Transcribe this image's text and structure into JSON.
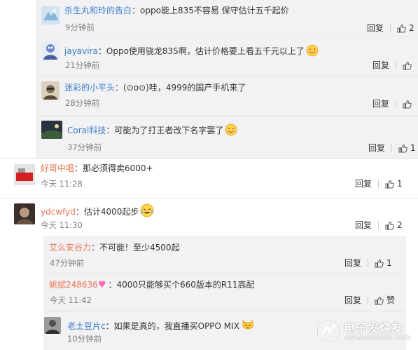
{
  "colors": {
    "nick_orange": "#eb7350",
    "nick_blue": "#3c7ec6",
    "panel_bg": "#f2f2f5",
    "heart": "#ff69b4"
  },
  "comments": [
    {
      "user": "杀生丸和玲的告白",
      "text": "oppo能上835不容易 保守估计五千起价",
      "time": "9分钟前",
      "reply": "回复",
      "likes": "2",
      "emoji": ""
    },
    {
      "user": "jayavira",
      "text": "Oppo使用骁龙835啊，估计价格要上看五千元以上了",
      "time": "21分钟前",
      "reply": "回复",
      "likes": "",
      "emoji": "smile-blush-emoji"
    },
    {
      "user": "迷彩的小平头",
      "text": "(⊙o⊙)哇，4999的国产手机来了",
      "time": "28分钟前",
      "reply": "回复",
      "likes": "",
      "emoji": ""
    },
    {
      "user": "Coral科技",
      "text": "可能为了打王者改下名字罢了",
      "time": "37分钟前",
      "reply": "回复",
      "likes": "1",
      "emoji": "smile-blush-emoji"
    },
    {
      "user": "好哥中唱",
      "text": "那必须得卖6000+",
      "time": "今天 11:28",
      "reply": "回复",
      "likes": "1",
      "emoji": ""
    },
    {
      "user": "ydcwfyd",
      "text": "估计4000起步",
      "time": "今天 11:30",
      "reply": "回复",
      "likes": "2",
      "emoji": "laugh-cry-emoji"
    },
    {
      "user": "艾么安谷力",
      "text": "不可能！至少4500起",
      "time": "47分钟前",
      "reply": "回复",
      "likes": "1",
      "emoji": ""
    },
    {
      "user": "姚斌248636",
      "text": "4000只能够买个660版本的R11高配",
      "time": "今天 11:42",
      "reply": "回复",
      "likes": "赞",
      "emoji": ""
    },
    {
      "user": "老土豆片c",
      "text": "如果是真的，我直播买OPPO MIX",
      "time": "10分钟前",
      "reply": "回复",
      "likes": "",
      "emoji": "cat-emoji"
    }
  ],
  "watermark": {
    "text": "电子发烧友",
    "url": "www.elecfans.com"
  }
}
